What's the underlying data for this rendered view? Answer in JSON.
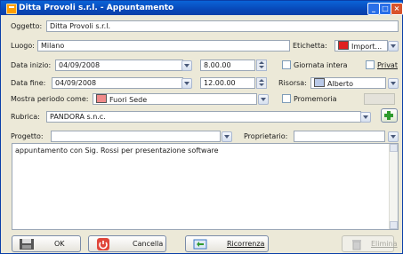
{
  "window": {
    "title": "Ditta Provoli s.r.l. - Appuntamento"
  },
  "oggetto": {
    "label": "Oggetto:",
    "value": "Ditta Provoli s.r.l."
  },
  "luogo": {
    "label": "Luogo:",
    "value": "Milano"
  },
  "etichetta": {
    "label": "Etichetta:",
    "value": "Import...",
    "color": "#e02020"
  },
  "data_inizio": {
    "label": "Data inizio:",
    "date": "04/09/2008",
    "time": "8.00.00"
  },
  "giornata_intera": {
    "label": "Giornata intera",
    "checked": false
  },
  "privato": {
    "label": "Privat",
    "checked": false
  },
  "data_fine": {
    "label": "Data fine:",
    "date": "04/09/2008",
    "time": "12.00.00"
  },
  "risorsa": {
    "label": "Risorsa:",
    "value": "Alberto",
    "color": "#b9c9e8"
  },
  "periodo": {
    "label": "Mostra periodo come:",
    "value": "Fuori Sede",
    "color": "#f08a8a"
  },
  "promemoria": {
    "label": "Promemoria",
    "checked": false
  },
  "rubrica": {
    "label": "Rubrica:",
    "value": "PANDORA s.n.c."
  },
  "progetto": {
    "label": "Progetto:",
    "value": ""
  },
  "proprietario": {
    "label": "Proprietario:",
    "value": ""
  },
  "note": {
    "text": "appuntamento con Sig. Rossi per presentazione software"
  },
  "buttons": {
    "ok": "OK",
    "cancella": "Cancella",
    "ricorrenza": "Ricorrenza",
    "elimina": "Elimina"
  },
  "icons": {
    "app": "calendar-icon",
    "add": "plus-icon",
    "ok": "disk-icon",
    "cancella": "power-icon",
    "ricorrenza": "recurrence-icon",
    "elimina": "trash-icon"
  }
}
